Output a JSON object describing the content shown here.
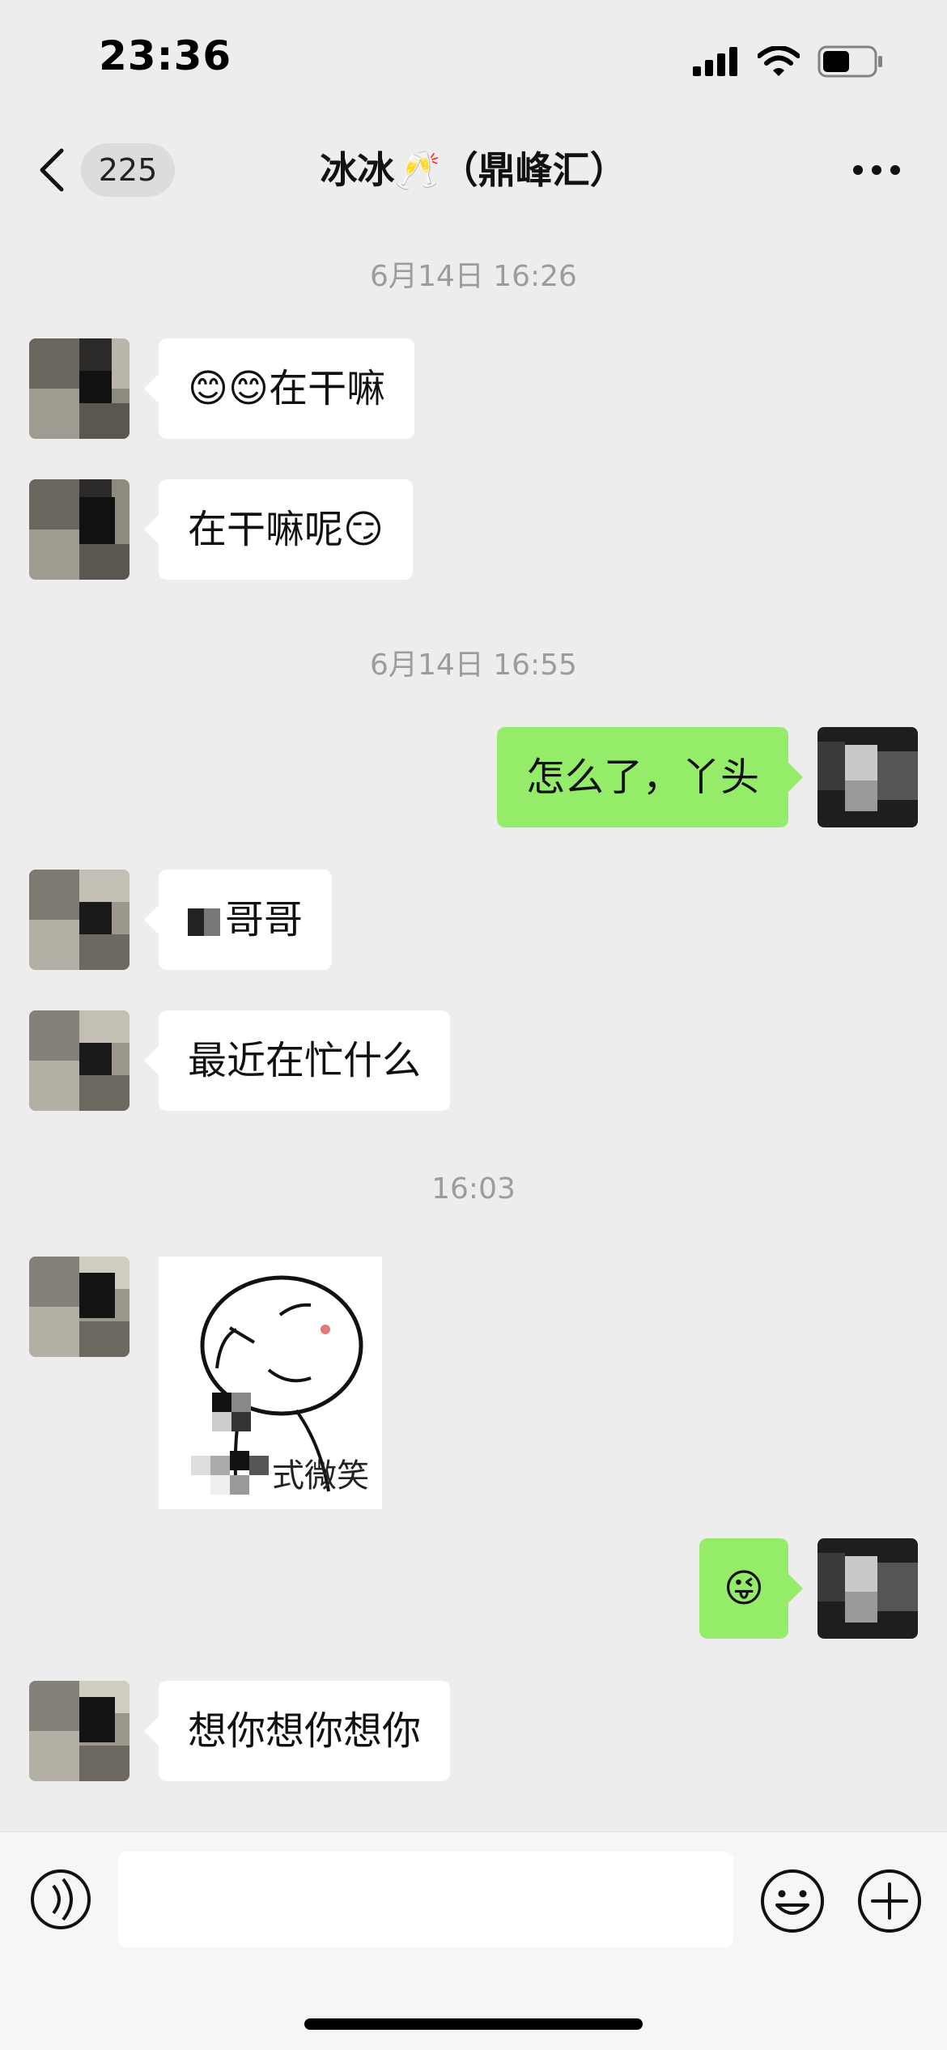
{
  "status_bar": {
    "time": "23:36",
    "icons": [
      "signal-icon",
      "wifi-icon",
      "battery-icon"
    ]
  },
  "nav": {
    "back_icon": "chevron-left-icon",
    "unread_count": "225",
    "title": "冰冰🥂（鼎峰汇）",
    "more_icon": "more-dots-icon"
  },
  "messages": [
    {
      "type": "timestamp",
      "text": "6月14日 16:26"
    },
    {
      "type": "text",
      "direction": "in",
      "text": "😊😊在干嘛"
    },
    {
      "type": "text",
      "direction": "in",
      "text": "在干嘛呢😏"
    },
    {
      "type": "timestamp",
      "text": "6月14日 16:55"
    },
    {
      "type": "text",
      "direction": "out",
      "text": "怎么了，丫头"
    },
    {
      "type": "text",
      "direction": "in",
      "text": "哥哥"
    },
    {
      "type": "text",
      "direction": "in",
      "text": "最近在忙什么"
    },
    {
      "type": "timestamp",
      "text": "16:03"
    },
    {
      "type": "sticker",
      "direction": "in",
      "caption": "式微笑"
    },
    {
      "type": "text",
      "direction": "out",
      "text": "😜"
    },
    {
      "type": "text",
      "direction": "in",
      "text": "想你想你想你"
    }
  ],
  "input_bar": {
    "voice_icon": "voice-toggle-icon",
    "input_value": "",
    "emoji_icon": "emoji-smile-icon",
    "plus_icon": "plus-circle-icon"
  },
  "colors": {
    "background": "#ededed",
    "incoming_bubble": "#ffffff",
    "outgoing_bubble": "#95ec69",
    "timestamp_text": "#9c9c9c"
  }
}
